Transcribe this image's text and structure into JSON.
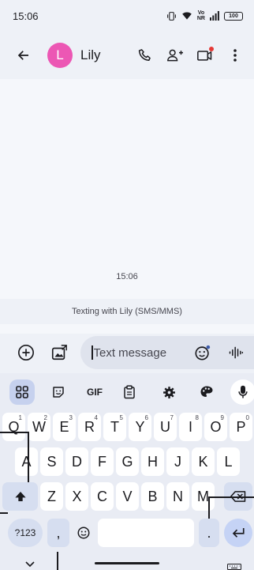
{
  "status_bar": {
    "time": "15:06",
    "volte_top": "Vo",
    "volte_bottom": "NR",
    "battery": "100"
  },
  "app_bar": {
    "avatar_letter": "L",
    "contact_name": "Lily"
  },
  "conversation": {
    "timestamp": "15:06",
    "texting_with": "Texting with Lily (SMS/MMS)"
  },
  "compose": {
    "placeholder": "Text message"
  },
  "keyboard": {
    "toolbar": {
      "gif_label": "GIF"
    },
    "row1": [
      {
        "label": "Q",
        "hint": "1"
      },
      {
        "label": "W",
        "hint": "2"
      },
      {
        "label": "E",
        "hint": "3"
      },
      {
        "label": "R",
        "hint": "4"
      },
      {
        "label": "T",
        "hint": "5"
      },
      {
        "label": "Y",
        "hint": "6"
      },
      {
        "label": "U",
        "hint": "7"
      },
      {
        "label": "I",
        "hint": "8"
      },
      {
        "label": "O",
        "hint": "9"
      },
      {
        "label": "P",
        "hint": "0"
      }
    ],
    "row2": [
      "A",
      "S",
      "D",
      "F",
      "G",
      "H",
      "J",
      "K",
      "L"
    ],
    "row3": [
      "Z",
      "X",
      "C",
      "V",
      "B",
      "N",
      "M"
    ],
    "symbols_label": "?123",
    "comma": ",",
    "period": "."
  },
  "colors": {
    "avatar": "#ec57b4",
    "video_badge": "#e53935",
    "accent": "#3d5ba9"
  },
  "icons": {
    "back": "arrow-left-icon",
    "call": "phone-icon",
    "add_person": "add-person-icon",
    "video": "video-call-icon",
    "more": "more-vert-icon",
    "attach": "add-circle-icon",
    "gallery": "gallery-icon",
    "emoji": "emoji-icon",
    "voice": "voice-waveform-icon"
  }
}
